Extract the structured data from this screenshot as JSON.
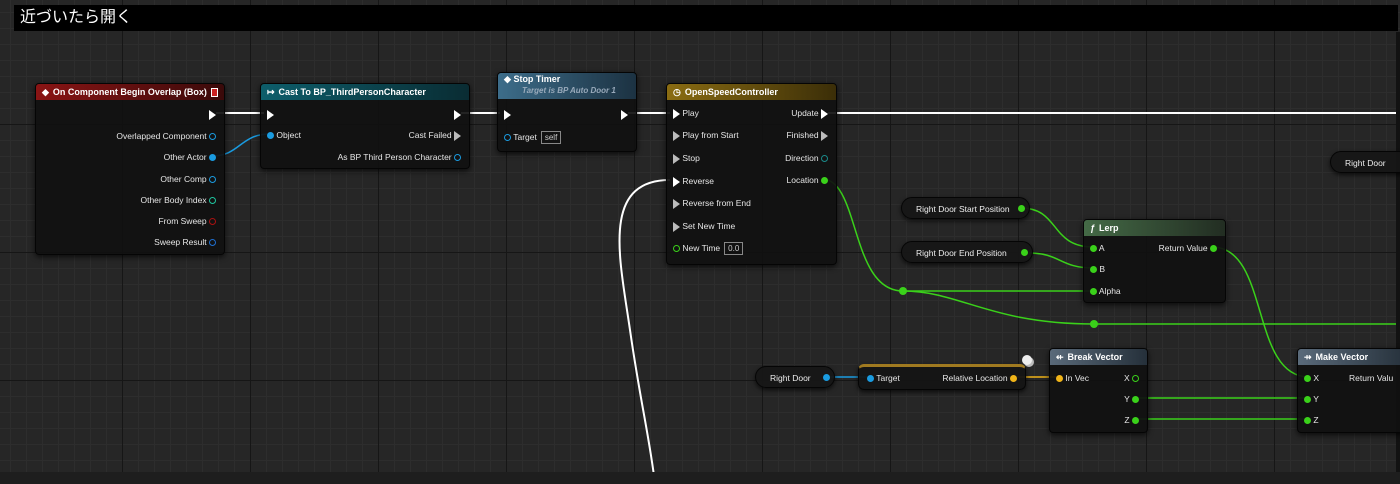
{
  "comment": {
    "title": "近づいたら開く"
  },
  "nodes": {
    "event": {
      "title": "On Component Begin Overlap (Box)",
      "outputs": [
        "Overlapped Component",
        "Other Actor",
        "Other Comp",
        "Other Body Index",
        "From Sweep",
        "Sweep Result"
      ]
    },
    "cast": {
      "title": "Cast To BP_ThirdPersonCharacter",
      "object_label": "Object",
      "cast_failed": "Cast Failed",
      "as_label": "As BP Third Person Character"
    },
    "stop_timer": {
      "title": "Stop Timer",
      "subtitle": "Target is BP Auto Door 1",
      "target_label": "Target",
      "target_value": "self"
    },
    "timeline": {
      "title": "OpenSpeedController",
      "inputs": [
        "Play",
        "Play from Start",
        "Stop",
        "Reverse",
        "Reverse from End",
        "Set New Time"
      ],
      "new_time_label": "New Time",
      "new_time_value": "0.0",
      "outputs": [
        "Update",
        "Finished",
        "Direction",
        "Location"
      ]
    },
    "var_start": {
      "label": "Right Door Start Position"
    },
    "var_end": {
      "label": "Right Door End Position"
    },
    "lerp": {
      "title": "Lerp",
      "a": "A",
      "b": "B",
      "alpha": "Alpha",
      "return": "Return Value"
    },
    "var_right_door": {
      "label": "Right Door"
    },
    "var_right_door_top": {
      "label": "Right Door"
    },
    "rel_loc": {
      "target": "Target",
      "output": "Relative Location"
    },
    "break_vec": {
      "title": "Break Vector",
      "in": "In Vec",
      "x": "X",
      "y": "Y",
      "z": "Z"
    },
    "make_vec": {
      "title": "Make Vector",
      "x": "X",
      "y": "Y",
      "z": "Z",
      "return": "Return Valu"
    }
  },
  "colors": {
    "exec": "#ffffff",
    "object_pin": "#1a9be0",
    "struct_pin": "#1f6fd0",
    "float_pin": "#3ad11a",
    "bool_pin": "#aa1111",
    "int_pin": "#1fc7a0",
    "vector_pin": "#f0b418"
  }
}
